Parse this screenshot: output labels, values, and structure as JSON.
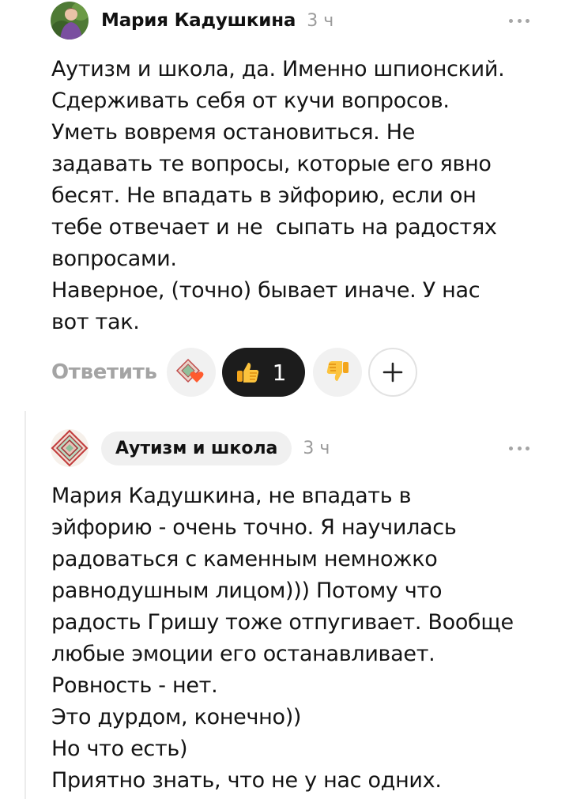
{
  "comments": [
    {
      "author": "Мария Кадушкина",
      "time": "3 ч",
      "text_lines": [
        "Аутизм и школа, да. Именно шпионский.",
        "Сдерживать себя от кучи вопросов.",
        "Уметь вовремя остановиться. Не",
        "задавать те вопросы, которые его явно",
        "бесят. Не впадать в эйфорию, если он",
        "тебе отвечает и не  сыпать на радостях",
        "вопросами.",
        "Наверное, (точно) бывает иначе. У нас",
        "вот так."
      ],
      "reply_label": "Ответить",
      "like_count": "1"
    },
    {
      "author": "Аутизм и школа",
      "time": "3 ч",
      "text_lines": [
        "Мария Кадушкина, не впадать в",
        "эйфорию - очень точно. Я научилась",
        "радоваться с каменным немножко",
        "равнодушным лицом))) Потому что",
        "радость Гришу тоже отпугивает. Вообще",
        "любые эмоции его останавливает.",
        "Ровность - нет.",
        "Это дурдом, конечно))",
        "Но что есть)",
        "Приятно знать, что не у нас одних."
      ]
    }
  ],
  "icons": {
    "more": "more-dots-icon",
    "like": "thumbs-up-icon",
    "dislike": "thumbs-down-icon",
    "add_reaction": "plus-icon",
    "reaction": "heart-reaction-icon"
  },
  "colors": {
    "like_bg": "#1c1c1c",
    "muted": "#9b9b9b",
    "pill_bg": "#f0f0f0"
  }
}
